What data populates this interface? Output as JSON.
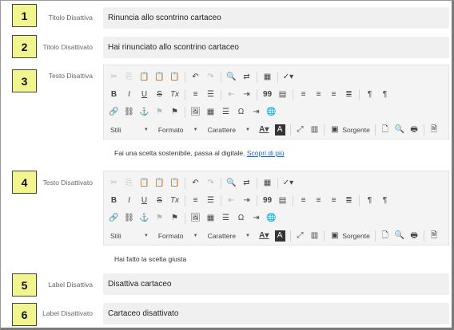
{
  "fields": [
    {
      "number": "1",
      "label": "Titolo Disattiva",
      "value": "Rinuncia allo scontrino cartaceo"
    },
    {
      "number": "2",
      "label": "Titolo Disattivato",
      "value": "Hai rinunciato allo scontrino cartaceo"
    },
    {
      "number": "3",
      "label": "Testo Disattiva",
      "content_text": "Fai una scelta sostenibile, passa al digitale.",
      "content_link": "Scopri di più"
    },
    {
      "number": "4",
      "label": "Testo Disattivato",
      "content_text": "Hai fatto la scelta giusta"
    },
    {
      "number": "5",
      "label": "Label Disattiva",
      "value": "Disattiva cartaceo"
    },
    {
      "number": "6",
      "label": "Label Disattivato",
      "value": "Cartaceo disattivato"
    }
  ],
  "toolbar": {
    "styles_combo": "Stili",
    "format_combo": "Formato",
    "font_combo": "Carattere",
    "source_button": "Sorgente",
    "bold_glyph": "B",
    "italic_glyph": "I",
    "underline_glyph": "U",
    "strike_glyph": "S",
    "removeformat_glyph": "Tx",
    "text_color_glyph": "A",
    "bg_color_glyph": "A",
    "omega_glyph": "Ω",
    "quote_glyph": "99"
  }
}
